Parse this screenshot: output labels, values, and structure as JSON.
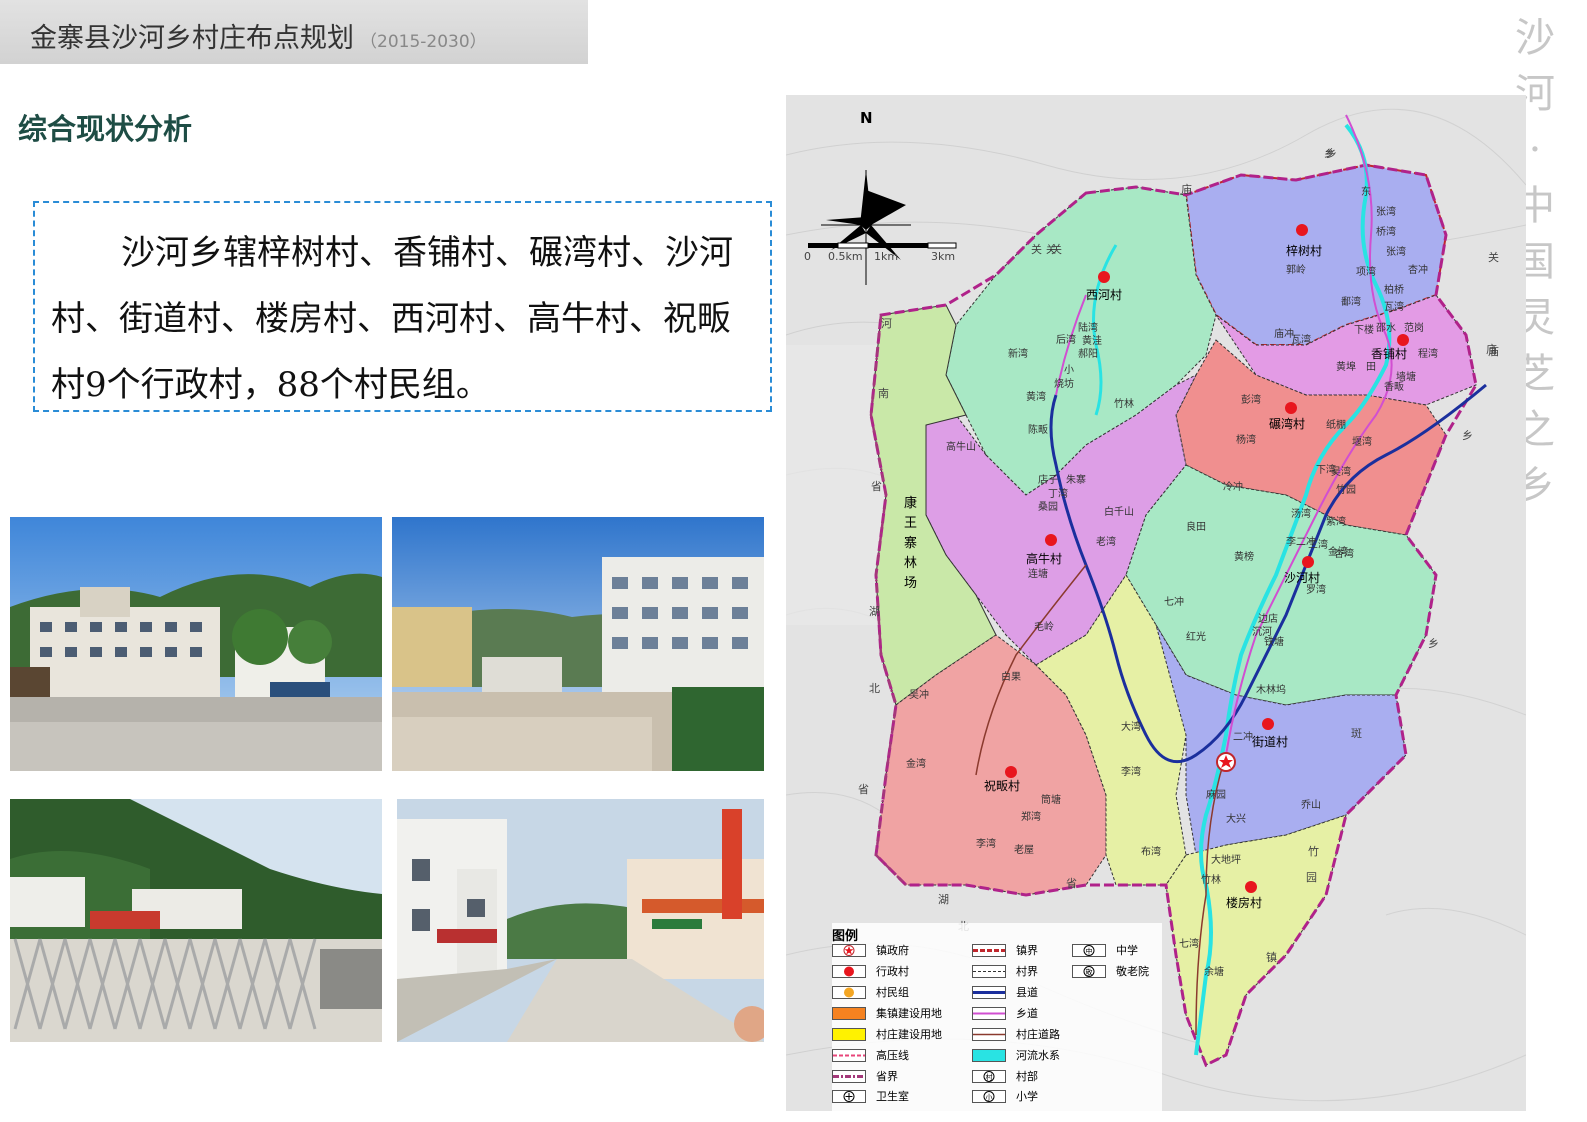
{
  "header": {
    "title": "金寨县沙河乡村庄布点规划",
    "years": "（2015-2030）"
  },
  "section_title": "综合现状分析",
  "summary": "沙河乡辖梓树村、香铺村、碾湾村、沙河村、街道村、楼房村、西河村、高牛村、祝畈村9个行政村，88个村民组。",
  "decor_vertical": [
    "沙",
    "河",
    "·",
    "中",
    "国",
    "灵",
    "芝",
    "之",
    "乡"
  ],
  "map": {
    "north": "N",
    "scale_ticks": [
      "0",
      "0.5km",
      "1km",
      "3km"
    ],
    "villages": [
      "西河村",
      "高牛村",
      "祝畈村",
      "梓树村",
      "香铺村",
      "碾湾村",
      "沙河村",
      "街道村",
      "楼房村"
    ],
    "forest_farm": [
      "康",
      "王",
      "寨",
      "林",
      "场"
    ],
    "group_labels": [
      "陆湾",
      "黄洼",
      "郝阳",
      "后湾",
      "新湾",
      "小",
      "烧坊",
      "黄湾",
      "竹林",
      "陈畈",
      "高牛山",
      "店子",
      "朱寨",
      "丁湾",
      "白千山",
      "桑园",
      "老湾",
      "连塘",
      "毛岭",
      "白果",
      "吴冲",
      "金湾",
      "筒塘",
      "郑湾",
      "李湾",
      "老屋",
      "大湾",
      "李湾",
      "布湾",
      "七冲",
      "红光",
      "良田",
      "黄榜",
      "冷冲",
      "三湾",
      "罗湾",
      "木林坞",
      "边店",
      "沉河",
      "铁塘",
      "二冲",
      "麻园",
      "大兴",
      "乔山",
      "大地坪",
      "竹林",
      "七湾",
      "杏湾",
      "余塘",
      "瓦湾",
      "下楼",
      "邵水",
      "范岗",
      "程湾",
      "黄埠",
      "田",
      "香畈",
      "墙塘",
      "彭湾",
      "纸棚",
      "杨湾",
      "堰湾",
      "吴湾",
      "竹园",
      "金湾",
      "汤湾",
      "紫湾",
      "桥湾",
      "张湾",
      "项湾",
      "杏冲",
      "柏桥",
      "鄱湾",
      "瓦湾",
      "庙冲",
      "李二冲",
      "张湾",
      "郭岭",
      "东",
      "下湾",
      "乡",
      "关"
    ],
    "border_labels": [
      "河",
      "南",
      "省",
      "湖",
      "北",
      "省",
      "湖",
      "北",
      "省",
      "庙",
      "关",
      "乡",
      "关",
      "庙",
      "乡",
      "乡",
      "斑",
      "竹",
      "园",
      "镇",
      "关",
      "庙"
    ],
    "legend_title": "图例",
    "legend": [
      {
        "label": "镇政府",
        "icon": "star-circle-icon"
      },
      {
        "label": "行政村",
        "icon": "red-dot-icon",
        "color": "#e8161e"
      },
      {
        "label": "村民组",
        "icon": "orange-dot-icon",
        "color": "#f4a623"
      },
      {
        "label": "集镇建设用地",
        "icon": "orange-fill",
        "color": "#f58220"
      },
      {
        "label": "村庄建设用地",
        "icon": "yellow-fill",
        "color": "#fff200"
      },
      {
        "label": "高压线",
        "icon": "pink-dash-line",
        "color": "#e8457a"
      },
      {
        "label": "省界",
        "icon": "purple-dash-line",
        "color": "#a4387a"
      },
      {
        "label": "卫生室",
        "icon": "cross-circle-icon"
      },
      {
        "label": "镇界",
        "icon": "red-dash-line",
        "color": "#c0272d"
      },
      {
        "label": "村界",
        "icon": "black-dash-line",
        "color": "#333333"
      },
      {
        "label": "县道",
        "icon": "blue-line",
        "color": "#1b2f9d"
      },
      {
        "label": "乡道",
        "icon": "magenta-line",
        "color": "#d14fd1"
      },
      {
        "label": "村庄道路",
        "icon": "brown-line",
        "color": "#8b3a2e"
      },
      {
        "label": "河流水系",
        "icon": "cyan-fill",
        "color": "#29e3e3"
      },
      {
        "label": "村部",
        "icon": "cun-circle-icon"
      },
      {
        "label": "小学",
        "icon": "xiao-circle-icon"
      },
      {
        "label": "中学",
        "icon": "zhong-circle-icon"
      },
      {
        "label": "敬老院",
        "icon": "jing-circle-icon"
      }
    ]
  },
  "photos": [
    {
      "scene": "township-government-building-photo"
    },
    {
      "scene": "office-building-courtyard-photo"
    },
    {
      "scene": "school-gate-hillside-photo"
    },
    {
      "scene": "town-street-photo"
    }
  ]
}
